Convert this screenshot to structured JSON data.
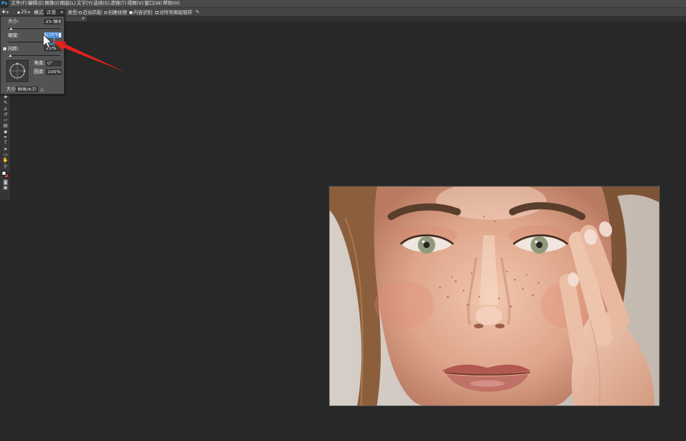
{
  "app": {
    "logo": "Ps"
  },
  "menu": [
    "文件(F)",
    "编辑(E)",
    "图像(I)",
    "图层(L)",
    "文字(Y)",
    "选择(S)",
    "滤镜(T)",
    "视图(V)",
    "窗口(W)",
    "帮助(H)"
  ],
  "options_bar": {
    "tool_icon": "spot-healing-brush-icon",
    "brush_size": "25",
    "mode_label": "模式:",
    "mode_value": "正常",
    "type_label": "类型:",
    "type_options": [
      {
        "label": "近似匹配",
        "selected": false
      },
      {
        "label": "创建纹理",
        "selected": false
      },
      {
        "label": "内容识别",
        "selected": true
      }
    ],
    "sample_all_layers": {
      "label": "对所有图层取样",
      "checked": false
    },
    "pressure_icon": "pen-pressure-icon"
  },
  "document_tab": {
    "close": "×"
  },
  "brush_panel": {
    "size": {
      "label": "大小:",
      "value": "25 像素",
      "slider": 0.06
    },
    "hardness": {
      "label": "硬度:",
      "value": "100%",
      "slider": 1.0
    },
    "spacing": {
      "label": "间距:",
      "value": "25%",
      "slider": 0.04,
      "enabled": true
    },
    "angle": {
      "label": "角度:",
      "value": "0°"
    },
    "roundness": {
      "label": "圆度:",
      "value": "100%"
    },
    "size_control": {
      "label": "大小:",
      "value": "钢笔压力"
    }
  },
  "toolbar": {
    "tools": [
      {
        "icon": "healing-brush-icon",
        "glyph": "✚"
      },
      {
        "icon": "brush-icon",
        "glyph": "✎"
      },
      {
        "icon": "clone-stamp-icon",
        "glyph": "♙"
      },
      {
        "icon": "history-brush-icon",
        "glyph": "↺"
      },
      {
        "icon": "eraser-icon",
        "glyph": "▱"
      },
      {
        "icon": "gradient-icon",
        "glyph": "▤"
      },
      {
        "icon": "blur-icon",
        "glyph": "◆"
      },
      {
        "icon": "pen-icon",
        "glyph": "✒"
      },
      {
        "icon": "type-icon",
        "glyph": "T"
      },
      {
        "icon": "path-selection-icon",
        "glyph": "➤"
      },
      {
        "icon": "rectangle-icon",
        "glyph": "▭"
      },
      {
        "icon": "hand-icon",
        "glyph": "✋"
      },
      {
        "icon": "zoom-icon",
        "glyph": "⚲"
      }
    ],
    "quick_mask": {
      "icon": "quick-mask-icon",
      "glyph": "◙"
    },
    "screen_mode": {
      "icon": "screen-mode-icon",
      "glyph": "▣"
    },
    "foreground_color": "#f4ece9",
    "background_color": "#cf4a3c"
  },
  "colors": {
    "logo": "#31a8ff",
    "annotation_arrow": "#e3211c",
    "selection": "#3b7bd6"
  }
}
